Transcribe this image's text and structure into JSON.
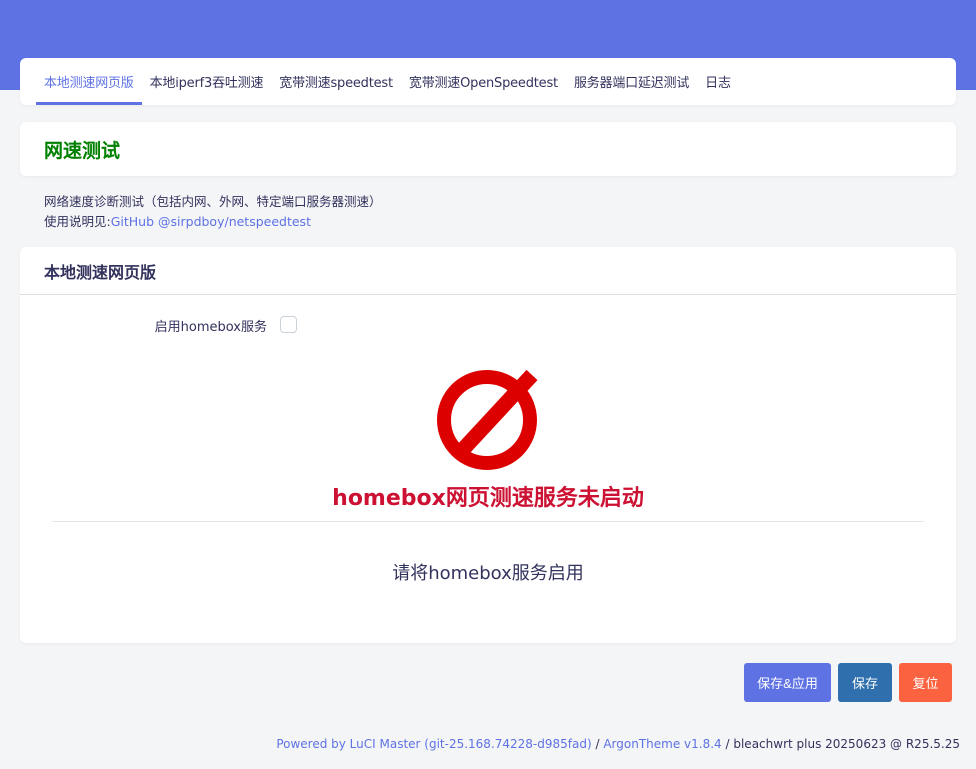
{
  "tabs": [
    {
      "label": "本地测速网页版",
      "active": true
    },
    {
      "label": "本地iperf3吞吐测速",
      "active": false
    },
    {
      "label": "宽带测速speedtest",
      "active": false
    },
    {
      "label": "宽带测速OpenSpeedtest",
      "active": false
    },
    {
      "label": "服务器端口延迟测试",
      "active": false
    },
    {
      "label": "日志",
      "active": false
    }
  ],
  "page": {
    "title": "网速测试",
    "description": "网络速度诊断测试（包括内网、外网、特定端口服务器测速）",
    "usage_prefix": "使用说明见:",
    "usage_link": "GitHub @sirpdboy/netspeedtest"
  },
  "section": {
    "title": "本地测速网页版",
    "enable_label": "启用homebox服务",
    "enable_checked": false,
    "status_icon": "forbidden-icon",
    "status_text": "homebox网页测速服务未启动",
    "hint_text": "请将homebox服务启用"
  },
  "buttons": {
    "save_apply": "保存&应用",
    "save": "保存",
    "reset": "复位"
  },
  "footer": {
    "powered": "Powered by LuCI Master (git-25.168.74228-d985fad)",
    "sep1": " / ",
    "theme": "ArgonTheme v1.8.4",
    "rest": " / bleachwrt plus 20250623 @ R25.5.25"
  },
  "colors": {
    "accent": "#5e72e4",
    "title_green": "#008000",
    "status_red": "#cc1133",
    "icon_red": "#dd0000",
    "save_blue": "#2f6fad",
    "reset_orange": "#fb6340"
  }
}
